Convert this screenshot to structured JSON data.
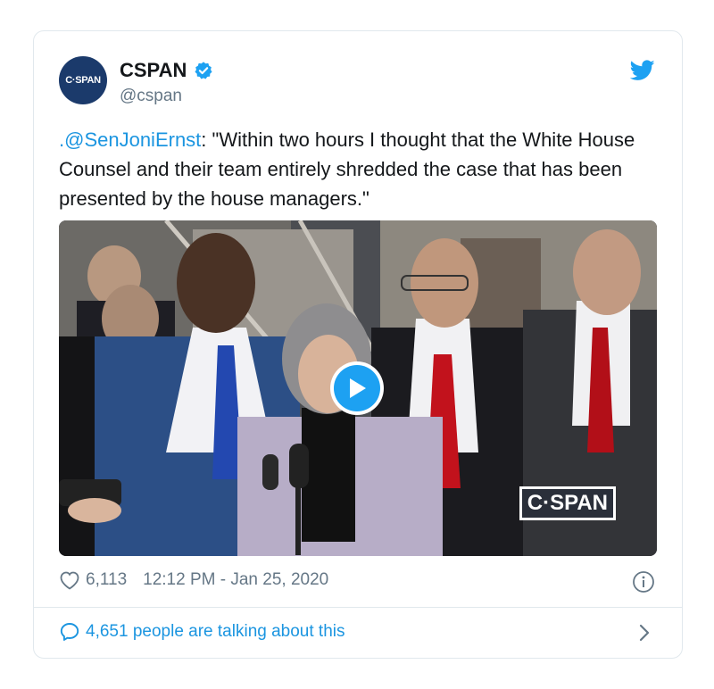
{
  "tweet": {
    "avatar_text": "C·SPAN",
    "display_name": "CSPAN",
    "handle": "@cspan",
    "text_mention": ".@SenJoniErnst",
    "text_body": ": \"Within two hours I thought that the White House Counsel and their team entirely shredded the case that has been presented by the house managers.\"",
    "media_watermark": "C·SPAN",
    "likes": "6,113",
    "timestamp": "12:12 PM - Jan 25, 2020",
    "talking": "4,651 people are talking about this"
  },
  "icons": {
    "verified": "verified-badge-icon",
    "bird": "twitter-bird-icon",
    "play": "play-icon",
    "heart": "heart-icon",
    "info": "info-icon",
    "bubble": "speech-bubble-icon",
    "chevron": "chevron-right-icon"
  },
  "colors": {
    "accent": "#1da1f2",
    "link": "#1b95e0",
    "muted": "#657786",
    "border": "#e1e8ed"
  }
}
